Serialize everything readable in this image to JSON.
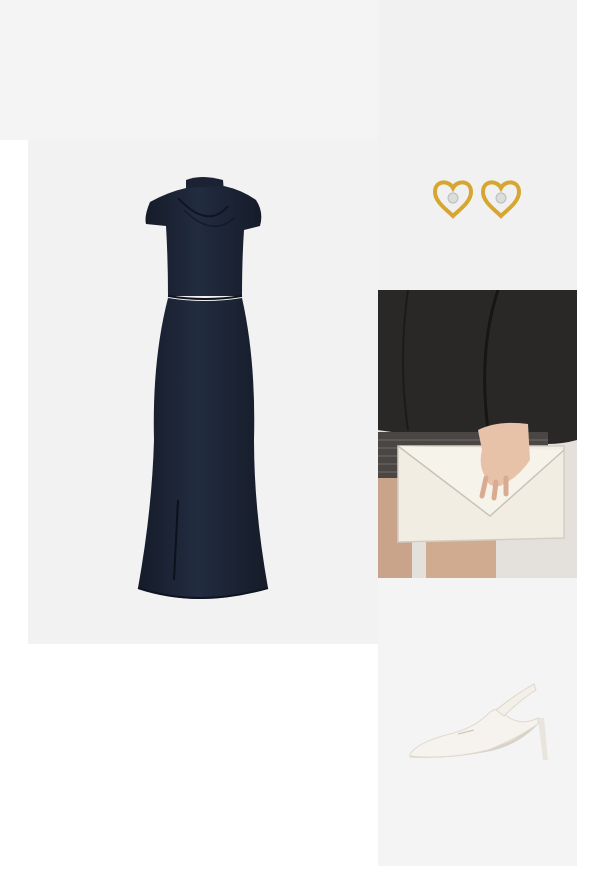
{
  "board": {
    "items": [
      {
        "id": "dress",
        "icon": "dress-icon"
      },
      {
        "id": "earrings",
        "icon": "heart-earrings-icon"
      },
      {
        "id": "clutch",
        "icon": "clutch-bag-icon"
      },
      {
        "id": "shoe",
        "icon": "slingback-pump-icon"
      }
    ]
  },
  "colors": {
    "dress": "#1d2536",
    "earring_gold": "#d6a630",
    "clutch": "#f1ede3",
    "blazer": "#2a2827",
    "shoe": "#f6f3ef"
  }
}
